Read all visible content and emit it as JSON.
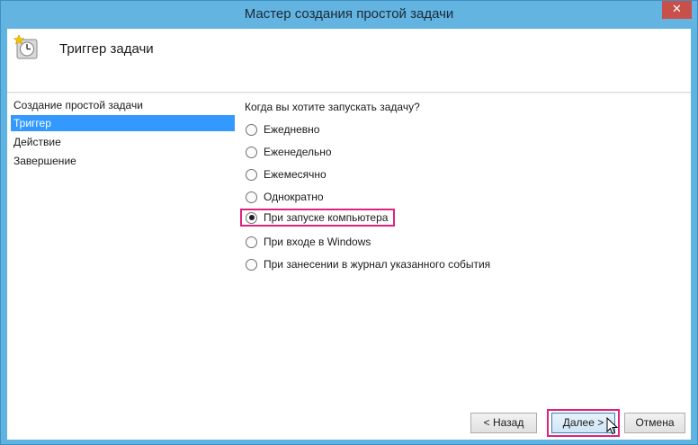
{
  "window": {
    "title": "Мастер создания простой задачи",
    "close_glyph": "✕"
  },
  "header": {
    "title": "Триггер задачи",
    "icon": "clock-icon"
  },
  "sidebar": {
    "items": [
      {
        "label": "Создание простой задачи",
        "active": false
      },
      {
        "label": "Триггер",
        "active": true
      },
      {
        "label": "Действие",
        "active": false
      },
      {
        "label": "Завершение",
        "active": false
      }
    ]
  },
  "main": {
    "question": "Когда вы хотите запускать задачу?",
    "options": [
      {
        "label": "Ежедневно",
        "checked": false
      },
      {
        "label": "Еженедельно",
        "checked": false
      },
      {
        "label": "Ежемесячно",
        "checked": false
      },
      {
        "label": "Однократно",
        "checked": false
      },
      {
        "label": "При запуске компьютера",
        "checked": true
      },
      {
        "label": "При входе в Windows",
        "checked": false
      },
      {
        "label": "При занесении в журнал указанного события",
        "checked": false
      }
    ]
  },
  "footer": {
    "back_label": "< Назад",
    "next_label": "Далее >",
    "cancel_label": "Отмена"
  },
  "colors": {
    "titlebar": "#63b4e1",
    "selection": "#3399ff",
    "highlight": "#e0217e",
    "close": "#c7504b"
  }
}
